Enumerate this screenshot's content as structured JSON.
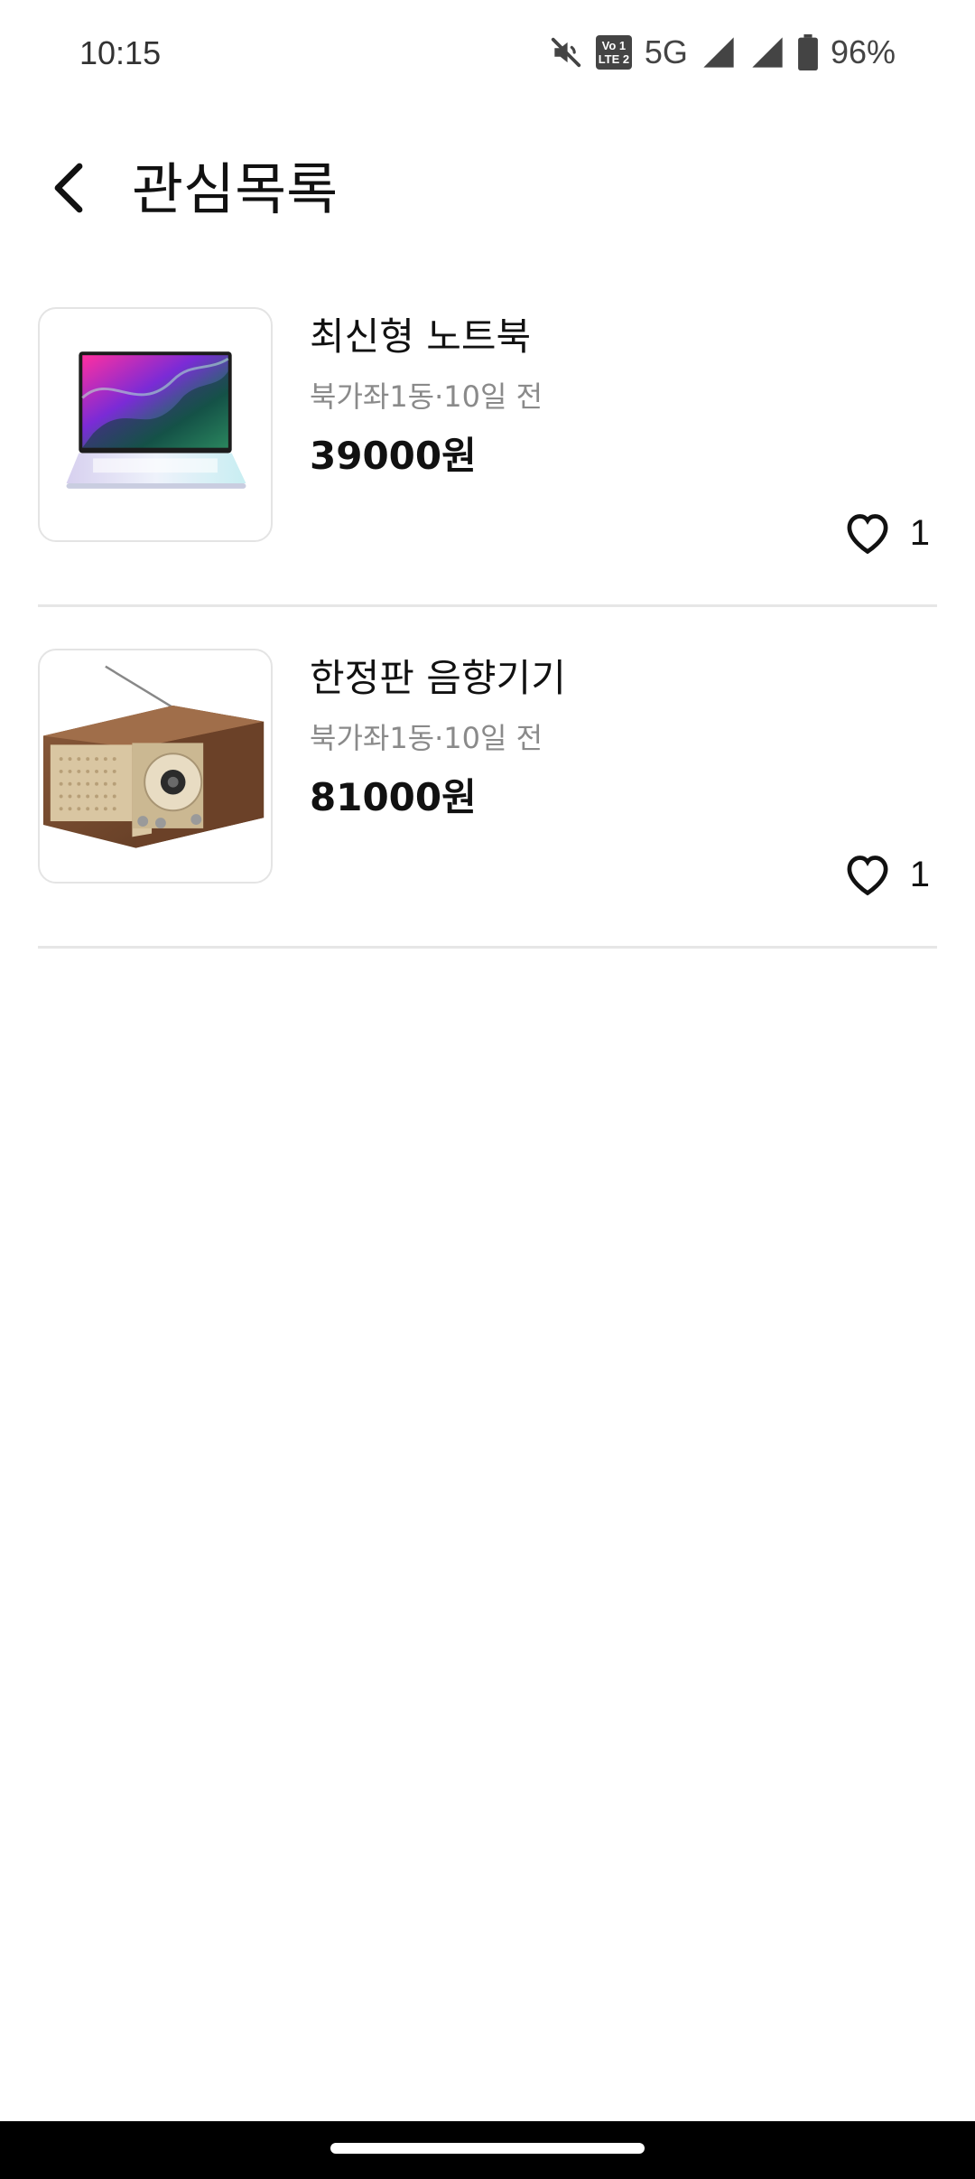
{
  "status_bar": {
    "time": "10:15",
    "volte_top": "Vo 1",
    "volte_bottom": "LTE 2",
    "network": "5G",
    "battery": "96%",
    "icons": [
      "mute-icon",
      "volte-icon",
      "signal-icon",
      "signal-icon",
      "battery-icon"
    ]
  },
  "header": {
    "title": "관심목록",
    "back_icon": "chevron-left-icon"
  },
  "items": [
    {
      "title": "최신형 노트북",
      "meta": "북가좌1동·10일 전",
      "price": "39000원",
      "likes": "1",
      "image_icon": "laptop-image"
    },
    {
      "title": "한정판 음향기기",
      "meta": "북가좌1동·10일 전",
      "price": "81000원",
      "likes": "1",
      "image_icon": "radio-image"
    }
  ],
  "colors": {
    "text_primary": "#111111",
    "text_secondary": "#8a8a8a",
    "divider": "#e6e6e6"
  }
}
